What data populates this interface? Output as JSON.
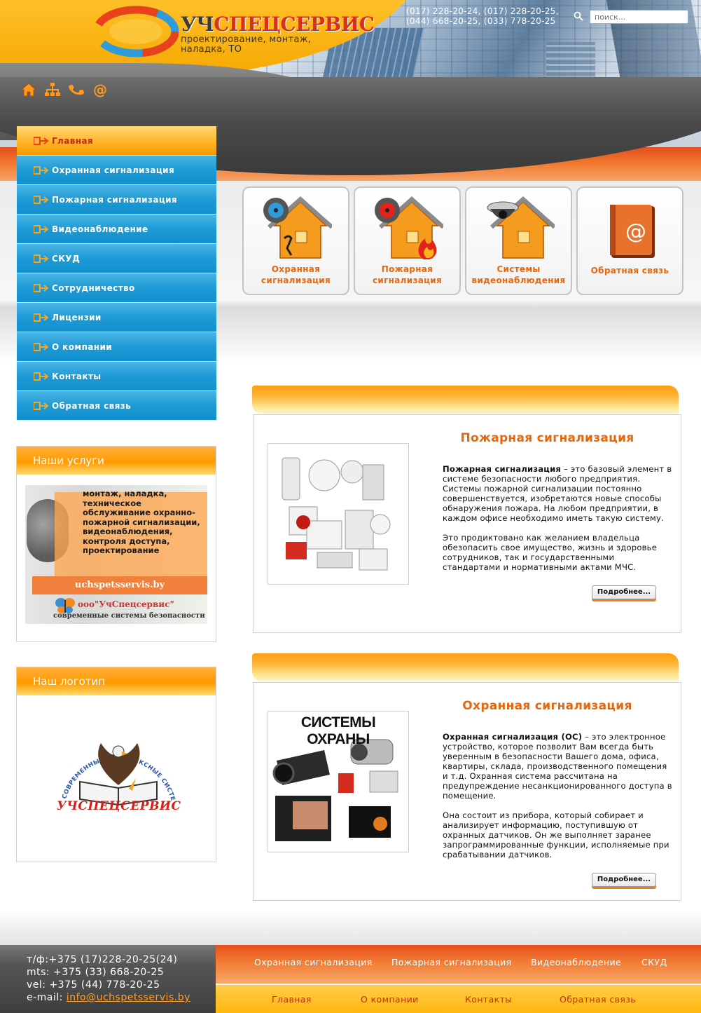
{
  "header": {
    "logo_word_dark": "УЧ",
    "logo_word_red": "СПЕЦСЕРВИС",
    "tagline": "проектирование, монтаж, наладка, ТО",
    "phones_line1": "(017) 228-20-24, (017) 228-20-25,",
    "phones_line2": "(044) 668-20-25, (033) 778-20-25",
    "search_placeholder": "поиск..."
  },
  "quick_icons": [
    "home-icon",
    "sitemap-icon",
    "phone-icon",
    "email-icon"
  ],
  "menu": {
    "items": [
      {
        "label": "Главная",
        "active": true
      },
      {
        "label": "Охранная сигнализация"
      },
      {
        "label": "Пожарная сигнализация"
      },
      {
        "label": "Видеонаблюдение"
      },
      {
        "label": "СКУД"
      },
      {
        "label": "Сотрудничество"
      },
      {
        "label": "Лицензии"
      },
      {
        "label": "О компании"
      },
      {
        "label": "Контакты"
      },
      {
        "label": "Обратная связь"
      }
    ]
  },
  "services_box": {
    "title": "Наши услуги",
    "banner_text": "монтаж, наладка, техническое обслуживание охранно-пожарной сигнализации, видеонаблюдения, контроля доступа, проектирование",
    "banner_site": "uchspetsservis.by",
    "banner_company": "ооо\"УчСпецсервис\"",
    "banner_slogan": "современные системы безопасности"
  },
  "logo_box": {
    "title": "Наш логотип",
    "emblem_arc_text": "СОВРЕМЕННЫЕ КОМПЛЕКСНЫЕ СИСТЕМЫ БЕЗОПАСНОСТИ",
    "emblem_word": "УЧСПЕЦСЕРВИС"
  },
  "tiles": [
    {
      "label": "Охранная сигнализация"
    },
    {
      "label": "Пожарная сигнализация"
    },
    {
      "label": "Системы видеонаблюдения"
    },
    {
      "label": "Обратная связь"
    }
  ],
  "articles": [
    {
      "title": "Пожарная сигнализация",
      "lead_bold": "Пожарная сигнализация",
      "lead_rest": " – это базовый элемент в системе безопасности любого предприятия. Системы пожарной сигнализации постоянно совершенствуется, изобретаются новые способы обнаружения пожара. На любом предприятии, в каждом офисе необходимо иметь такую систему.",
      "para2": "Это продиктовано как желанием владельца обезопасить свое имущество, жизнь и здоровье сотрудников, так и государственными стандартами и нормативными актами МЧС.",
      "more_label": "Подробнее..."
    },
    {
      "title": "Охранная сигнализация",
      "image_caption": "СИСТЕМЫ ОХРАНЫ",
      "lead_bold": "Охранная сигнализация (ОС)",
      "lead_rest": " – это электронное устройство, которое позволит Вам всегда быть уверенным в безопасности Вашего дома, офиса, квартиры, склада, производственного помещения и т.д. Охранная система рассчитана на предупреждение несанкционированного доступа в помещение.",
      "para2": "Она состоит из прибора, который собирает и анализирует информацию, поступившую от охранных датчиков. Он же выполняет заранее запрограммированные функции, исполняемые при срабатывании датчиков.",
      "more_label": "Подробнее..."
    }
  ],
  "footer": {
    "contact_line1": "т/ф:+375 (17)228-20-25(24)",
    "contact_line2": "mts: +375 (33) 668-20-25",
    "contact_line3": "vel: +375 (44) 778-20-25",
    "email_label": "e-mail: ",
    "email": "info@uchspetsservis.by",
    "top_nav": [
      "Охранная сигнализация",
      "Пожарная сигнализация",
      "Видеонаблюдение",
      "СКУД"
    ],
    "bottom_nav": [
      "Главная",
      "О компании",
      "Контакты",
      "Обратная связь"
    ]
  },
  "colors": {
    "accent_orange": "#e8670c",
    "menu_blue": "#1e9ad6",
    "menu_active": "#ffb428",
    "footer_red": "#e6501d",
    "active_text": "#c42b16"
  }
}
